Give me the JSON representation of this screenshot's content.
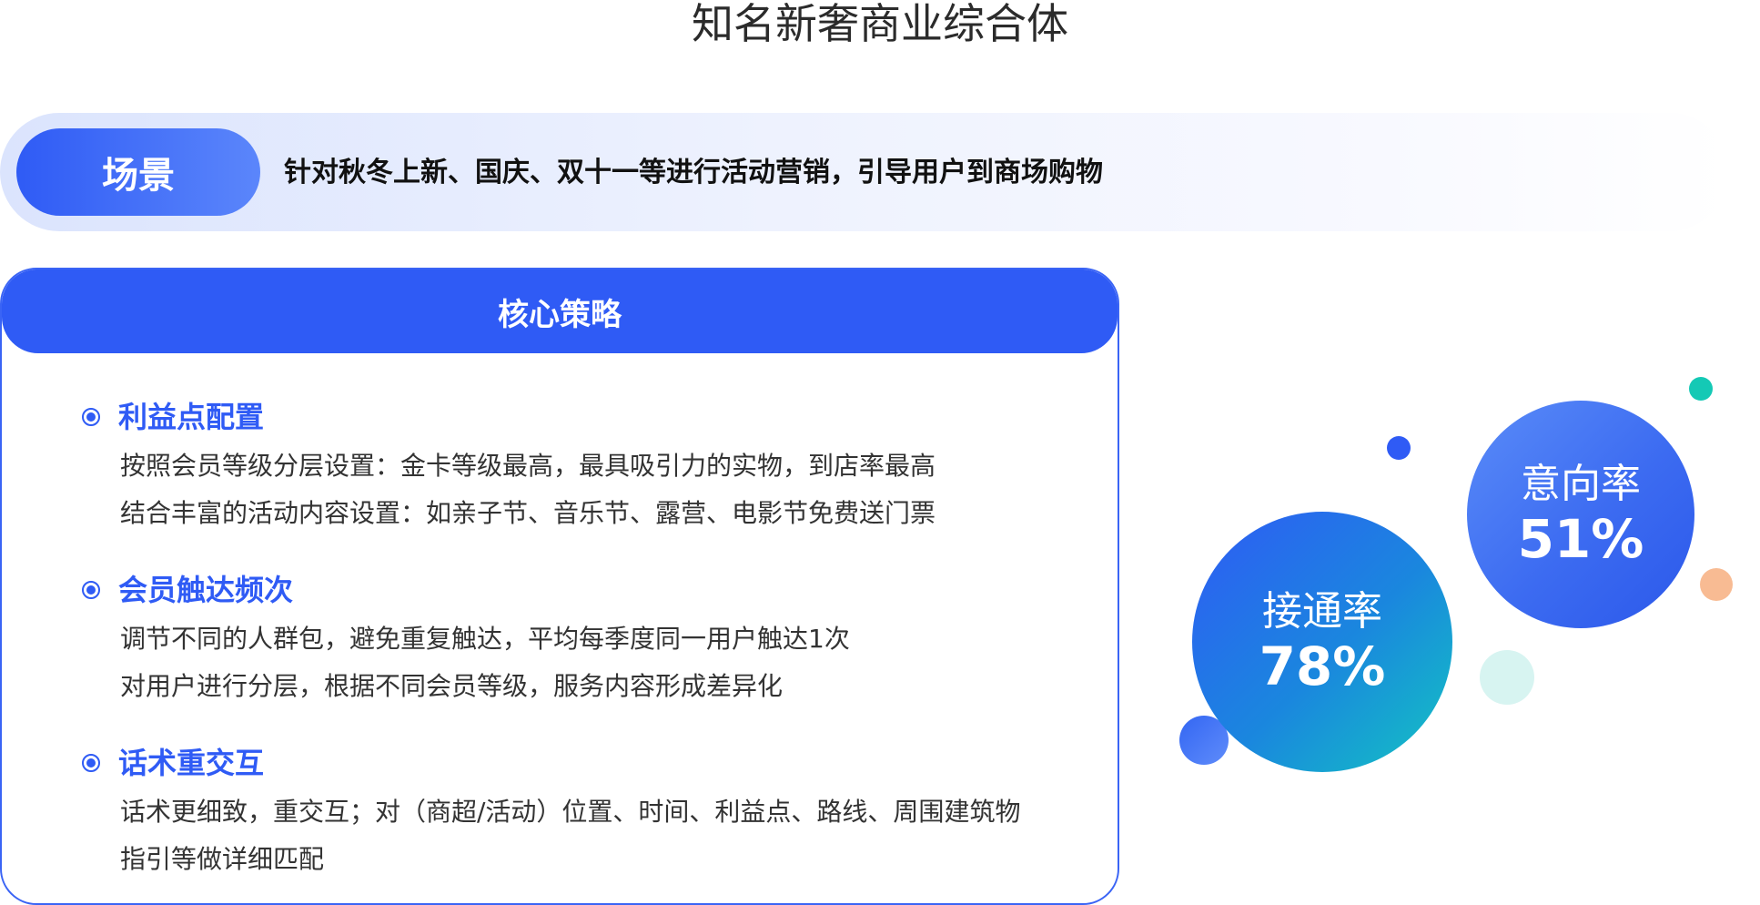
{
  "page": {
    "title": "知名新奢商业综合体"
  },
  "scene": {
    "label": "场景",
    "text": "针对秋冬上新、国庆、双十一等进行活动营销，引导用户到商场购物"
  },
  "strategy": {
    "header": "核心策略",
    "sections": [
      {
        "title": "利益点配置",
        "lines": [
          "按照会员等级分层设置：金卡等级最高，最具吸引力的实物，到店率最高",
          "结合丰富的活动内容设置：如亲子节、音乐节、露营、电影节免费送门票"
        ]
      },
      {
        "title": "会员触达频次",
        "lines": [
          "调节不同的人群包，避免重复触达，平均每季度同一用户触达1次",
          "对用户进行分层，根据不同会员等级，服务内容形成差异化"
        ]
      },
      {
        "title": "话术重交互",
        "lines": [
          "话术更细致，重交互；对（商超/活动）位置、时间、利益点、路线、周围建筑物",
          "指引等做详细匹配"
        ]
      }
    ]
  },
  "metrics": {
    "intent": {
      "label": "意向率",
      "value": "51%"
    },
    "connect": {
      "label": "接通率",
      "value": "78%"
    }
  },
  "colors": {
    "primary": "#2f5bf5",
    "teal": "#14c9b5",
    "orange": "#f8bb93"
  }
}
